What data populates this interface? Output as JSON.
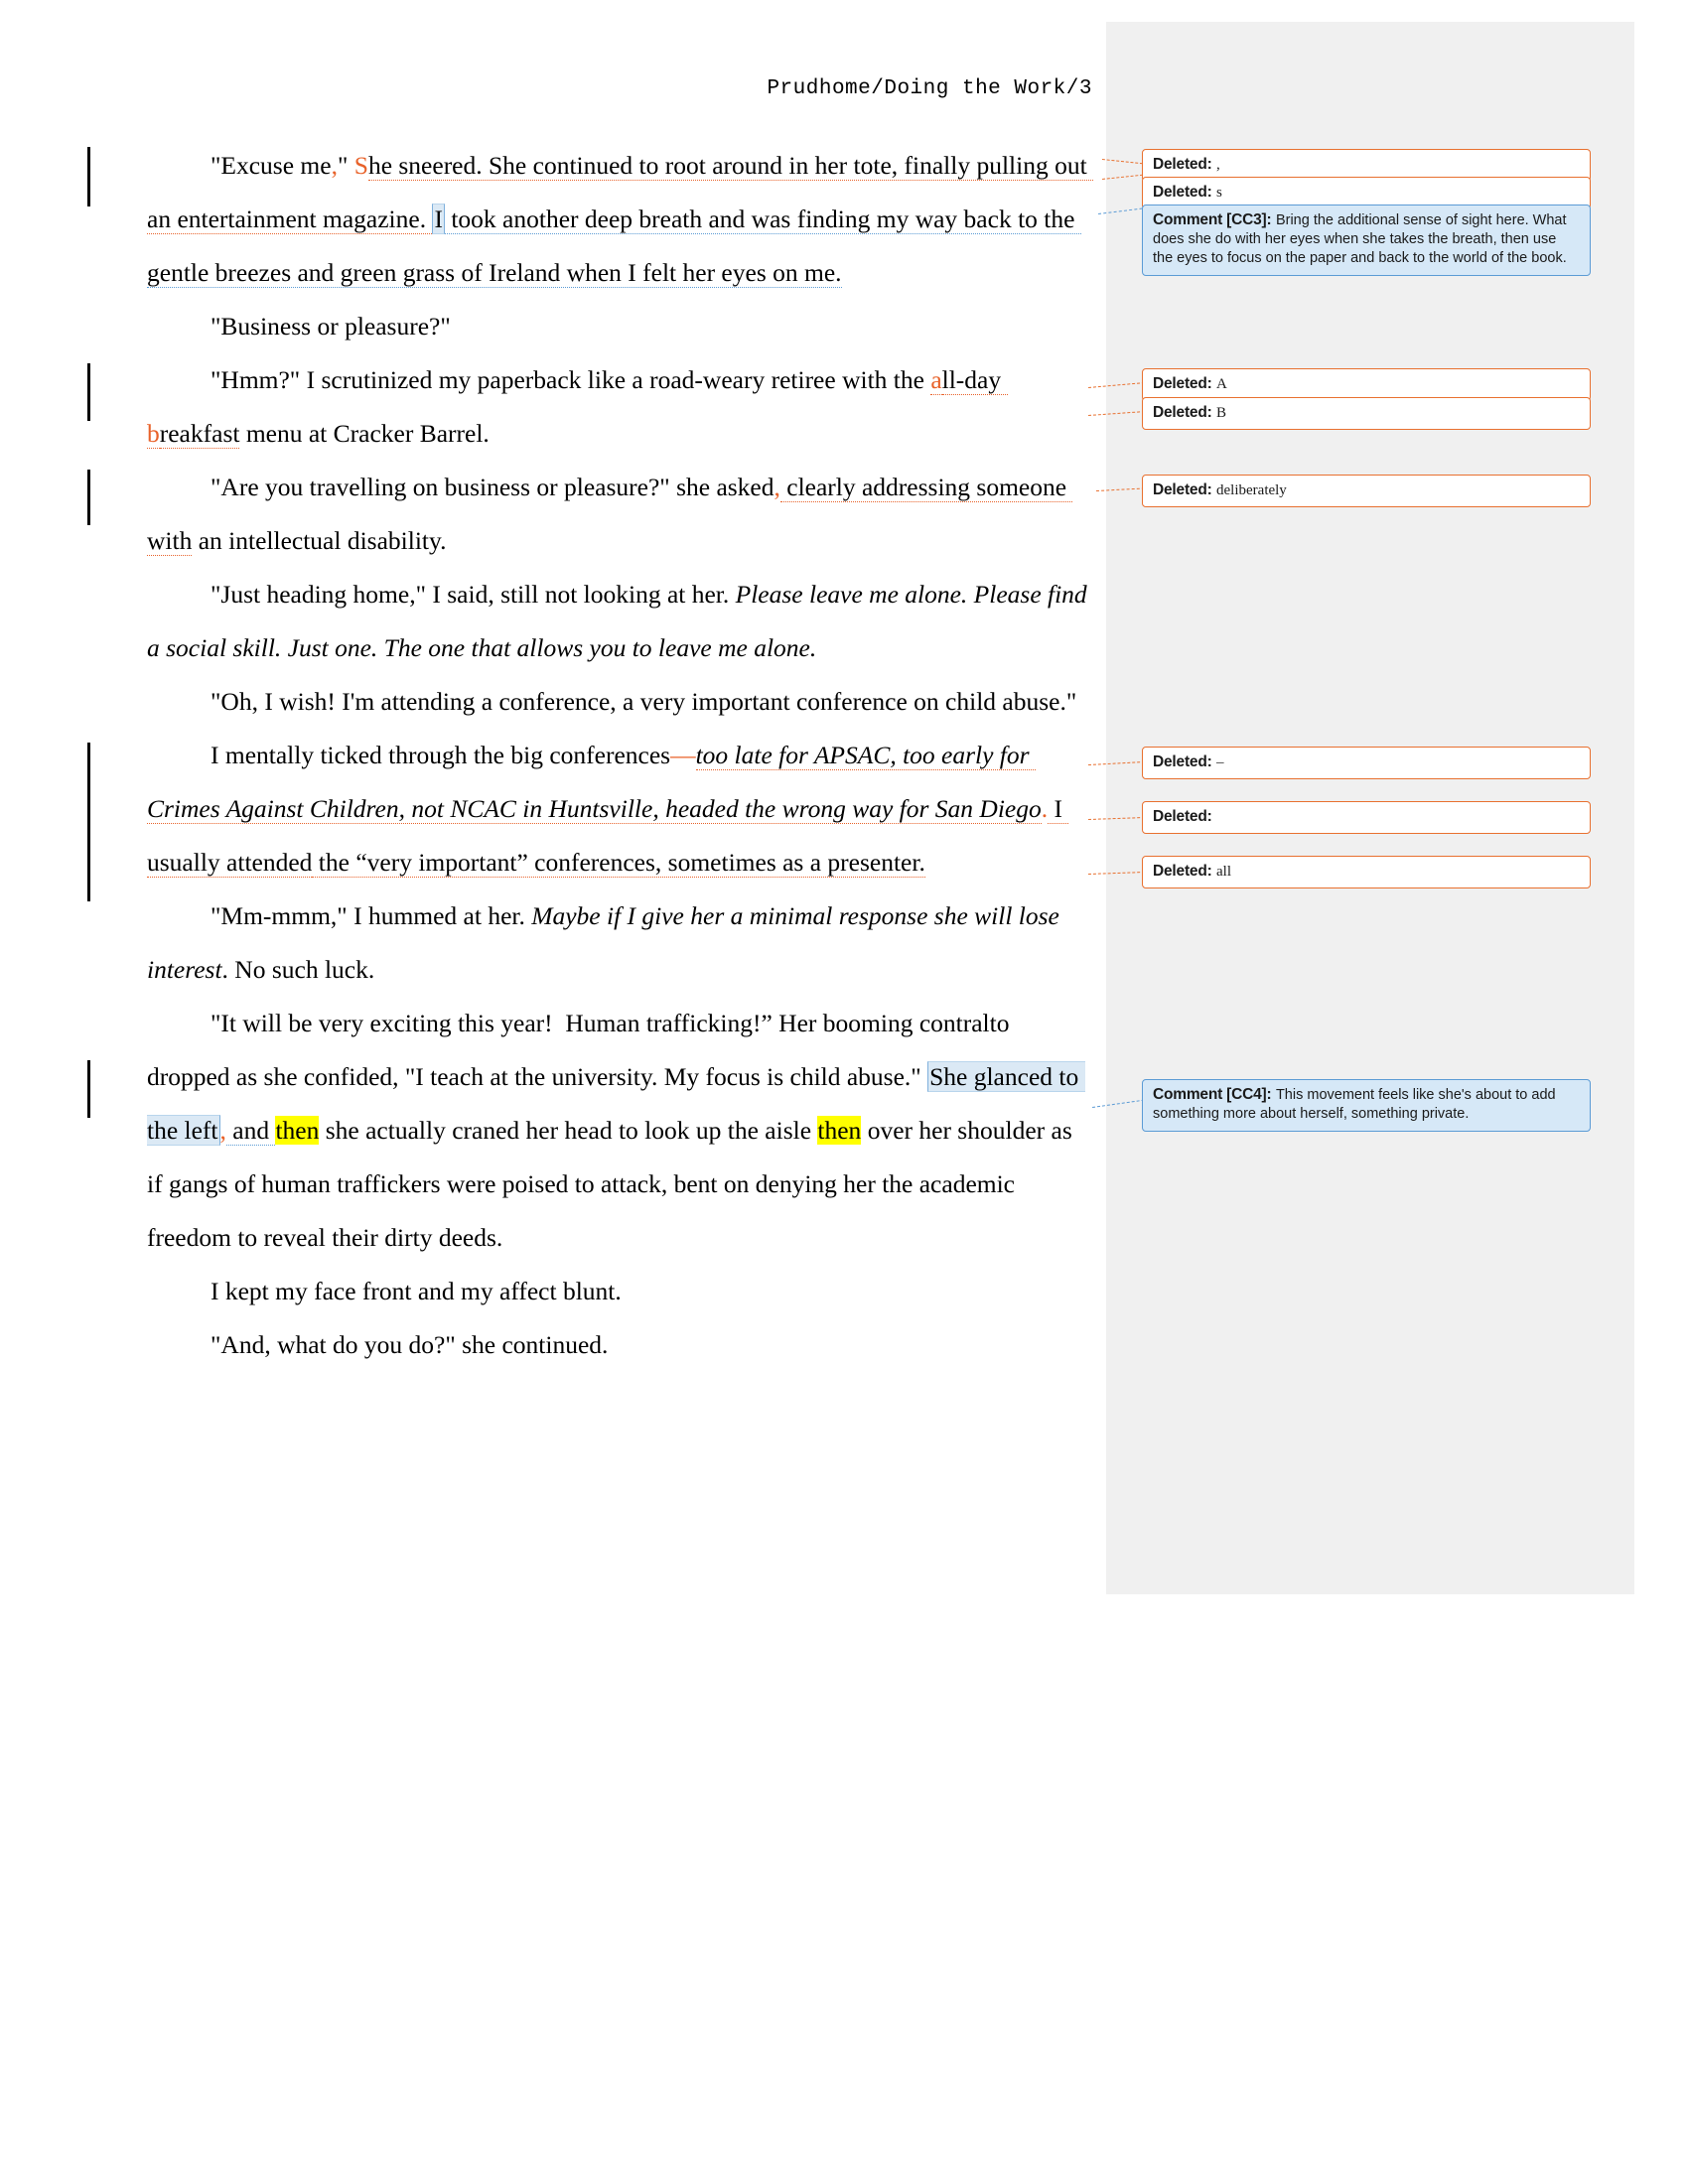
{
  "document": {
    "running_header": "Prudhome/Doing the Work/3",
    "page_number": "3"
  },
  "body": {
    "paragraphs": [
      {
        "id": "p1",
        "segments": [
          {
            "text": "\"Excuse me",
            "style": "normal"
          },
          {
            "text": ",",
            "style": "inserted-mark"
          },
          {
            "text": "\" ",
            "style": "normal"
          },
          {
            "text": "S",
            "style": "inserted"
          },
          {
            "text": "he sneered. She continued to root around in her tote, finally pulling out an entertainment magazine. ",
            "style": "inserted-underline"
          },
          {
            "text": "I",
            "style": "comment-highlight"
          },
          {
            "text": " took another deep breath and was finding my way back to the gentle breezes and green grass of Ireland when I felt her eyes on me.",
            "style": "comment-underline"
          }
        ],
        "plain": "\"Excuse me,\" She sneered. She continued to root around in her tote, finally pulling out an entertainment magazine. I took another deep breath and was finding my way back to the gentle breezes and green grass of Ireland when I felt her eyes on me."
      },
      {
        "id": "p2",
        "plain": "\"Business or pleasure?\""
      },
      {
        "id": "p3",
        "plain": "\"Hmm?\" I scrutinized my paperback like a road-weary retiree with the all-day breakfast menu at Cracker Barrel."
      },
      {
        "id": "p4",
        "plain": "\"Are you travelling on business or pleasure?\" she asked, clearly addressing someone with an intellectual disability."
      },
      {
        "id": "p5",
        "plain": "\"Just heading home,\" I said, still not looking at her. Please leave me alone. Please find a social skill. Just one. The one that allows you to leave me alone."
      },
      {
        "id": "p6",
        "plain": "\"Oh, I wish! I'm attending a conference, a very important conference on child abuse.\""
      },
      {
        "id": "p7",
        "plain": "I mentally ticked through the big conferences—too late for APSAC, too early for Crimes Against Children, not NCAC in Huntsville, headed the wrong way for San Diego. I usually attended the “very important” conferences, sometimes as a presenter."
      },
      {
        "id": "p8",
        "plain": "\"Mm-mmm,\" I hummed at her. Maybe if I give her a minimal response she will lose interest. No such luck."
      },
      {
        "id": "p9",
        "plain": "\"It will be very exciting this year!  Human trafficking!” Her booming contralto dropped as she confided, \"I teach at the university. My focus is child abuse.\" She glanced to the left, and then she actually craned her head to look up the aisle then over her shoulder as if gangs of human traffickers were poised to attack, bent on denying her the academic freedom to reveal their dirty deeds."
      },
      {
        "id": "p10",
        "plain": "I kept my face front and my affect blunt."
      },
      {
        "id": "p11",
        "plain": "\"And, what do you do?\" she continued."
      }
    ],
    "text_fragments": {
      "p1_a": "\"Excuse me",
      "p1_comma": ",",
      "p1_quote": "\" ",
      "p1_S": "S",
      "p1_b": "he sneered. She continued to root around in her tote, finally pulling out an entertainment magazine. ",
      "p1_I": "I",
      "p1_c": " took another deep breath and was finding my way back to the gentle breezes and green grass of Ireland when I felt her eyes on me.",
      "p2": "\"Business or pleasure?\"",
      "p3_a": "\"Hmm?\" I scrutinized my paperback like a road-weary retiree with the ",
      "p3_ins_a": "a",
      "p3_b": "ll-day ",
      "p3_ins_b": "b",
      "p3_c": "reakfast",
      "p3_d": " menu at Cracker Barrel.",
      "p4_a": "\"Are you travelling on business or pleasure?\" she asked",
      "p4_comma": ",",
      "p4_b": " clearly addressing someone with",
      "p4_c": " an intellectual disability.",
      "p5_a": "\"Just heading home,\" I said, still not looking at her. ",
      "p5_it": "Please leave me alone. Please find a social skill. Just one. The one that allows you to leave me alone.",
      "p6": "\"Oh, I wish! I'm attending a conference, a very important conference on child abuse.\"",
      "p7_a": "I mentally ticked through the big conferences",
      "p7_dash": "—",
      "p7_it": "too late for APSAC, too early for Crimes Against Children, not NCAC in Huntsville, headed the wrong way for San Diego",
      "p7_period": ".",
      "p7_b": " I usually attended",
      "p7_c": " the “very important” conferences, sometimes as a presenter.",
      "p8_a": "\"Mm-mmm,\" I hummed at her. ",
      "p8_it": "Maybe if I give her a minimal response she will lose interest",
      "p8_b": ". No such luck.",
      "p9_a": "\"It will be very exciting this year!  Human trafficking!” Her booming contralto dropped as she confided, \"I teach at the university. My focus is child abuse.\" ",
      "p9_hl": "She glanced to the left",
      "p9_comma": ",",
      "p9_b": " and ",
      "p9_then1": "then",
      "p9_c": " she actually craned her head to look up the aisle ",
      "p9_then2": "then",
      "p9_d": " over her shoulder as if gangs of human traffickers were poised to attack, bent on denying her the academic freedom to reveal their dirty deeds.",
      "p10": "I kept my face front and my affect blunt.",
      "p11": "\"And, what do you do?\" she continued."
    }
  },
  "markup": {
    "label_deleted": "Deleted:",
    "label_comment_cc3": "Comment [CC3]:",
    "label_comment_cc4": "Comment [CC4]:",
    "balloons": [
      {
        "id": "b1",
        "type": "deleted",
        "label": "Deleted:",
        "text": ","
      },
      {
        "id": "b2",
        "type": "deleted",
        "label": "Deleted:",
        "text": "s"
      },
      {
        "id": "b3",
        "type": "comment",
        "label": "Comment [CC3]:",
        "text": "Bring the additional sense of sight here. What does she do with her eyes when she takes the breath, then use the eyes to focus on the paper and back to the world of the book."
      },
      {
        "id": "b4",
        "type": "deleted",
        "label": "Deleted:",
        "text": "A"
      },
      {
        "id": "b5",
        "type": "deleted",
        "label": "Deleted:",
        "text": "B"
      },
      {
        "id": "b6",
        "type": "deleted",
        "label": "Deleted:",
        "text": " deliberately"
      },
      {
        "id": "b7",
        "type": "deleted",
        "label": "Deleted:",
        "text": " –"
      },
      {
        "id": "b8",
        "type": "deleted",
        "label": "Deleted:",
        "text": ""
      },
      {
        "id": "b9",
        "type": "deleted",
        "label": "Deleted:",
        "text": "all"
      },
      {
        "id": "b10",
        "type": "comment",
        "label": "Comment [CC4]:",
        "text": "This movement feels like she's about to add something more about herself, something private."
      }
    ]
  },
  "colors": {
    "insertion": "#e8622a",
    "deleted_border": "#e8702f",
    "comment_border": "#5b9bd5",
    "comment_fill": "#d6e8f7",
    "comment_highlight": "#dbe9f5",
    "text_highlight": "#ffff00",
    "markup_panel": "#f0f0f0",
    "change_bar": "#000000"
  }
}
